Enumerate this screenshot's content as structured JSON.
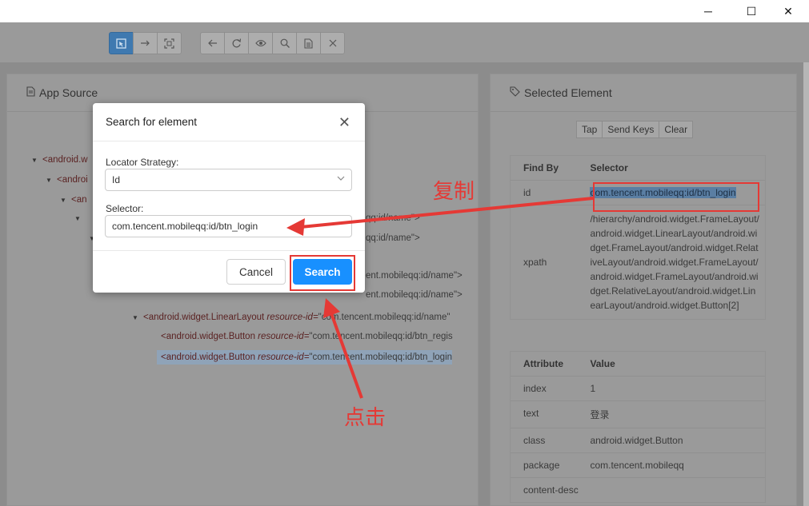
{
  "window": {
    "controls": [
      "─",
      "☐",
      "✕"
    ]
  },
  "toolbar": {
    "group1": [
      "select-element-icon",
      "swipe-icon",
      "tap-coordinates-icon"
    ],
    "group2": [
      "back-icon",
      "refresh-icon",
      "eye-icon",
      "search-icon",
      "copy-xml-icon",
      "quit-icon"
    ]
  },
  "app_source": {
    "title": "App Source",
    "tree": [
      {
        "text": "<android.w",
        "depth": 0,
        "caret": true
      },
      {
        "text": "<androi",
        "depth": 1,
        "caret": true
      },
      {
        "text": "<an",
        "depth": 2,
        "caret": true
      },
      {
        "tail": "qq:id/name\">",
        "depth": 3,
        "caret": true
      },
      {
        "tail": "qq:id/name\">",
        "depth": 4,
        "caret": true
      },
      {
        "tail": "ent.mobileqq:id/name\">",
        "depth": 5,
        "caret": false
      },
      {
        "tail": "ent.mobileqq:id/name\">",
        "depth": 5,
        "caret": false
      }
    ],
    "linear_layout": {
      "tag": "<android.widget.LinearLayout",
      "attr": "resource-id=",
      "value": "\"com.tencent.mobileqq:id/name\""
    },
    "button_register": {
      "tag": "<android.widget.Button",
      "attr": "resource-id=",
      "value": "\"com.tencent.mobileqq:id/btn_regis"
    },
    "button_login": {
      "tag": "<android.widget.Button",
      "attr": "resource-id=",
      "value": "\"com.tencent.mobileqq:id/btn_login"
    }
  },
  "selected_element": {
    "title": "Selected Element",
    "actions": [
      "Tap",
      "Send Keys",
      "Clear"
    ],
    "find_by_header": {
      "col1": "Find By",
      "col2": "Selector"
    },
    "find_by": [
      {
        "key": "id",
        "value": "com.tencent.mobileqq:id/btn_login"
      },
      {
        "key": "xpath",
        "value": "/hierarchy/android.widget.FrameLayout/android.widget.LinearLayout/android.widget.FrameLayout/android.widget.RelativeLayout/android.widget.FrameLayout/android.widget.FrameLayout/android.widget.RelativeLayout/android.widget.LinearLayout/android.widget.Button[2]"
      }
    ],
    "attr_header": {
      "col1": "Attribute",
      "col2": "Value"
    },
    "attributes": [
      {
        "key": "index",
        "value": "1"
      },
      {
        "key": "text",
        "value": "登录"
      },
      {
        "key": "class",
        "value": "android.widget.Button"
      },
      {
        "key": "package",
        "value": "com.tencent.mobileqq"
      },
      {
        "key": "content-desc",
        "value": ""
      }
    ]
  },
  "modal": {
    "title": "Search for element",
    "locator_label": "Locator Strategy:",
    "locator_value": "Id",
    "selector_label": "Selector:",
    "selector_value": "com.tencent.mobileqq:id/btn_login",
    "cancel": "Cancel",
    "search": "Search"
  },
  "annotations": {
    "copy": "复制",
    "click": "点击",
    "color": "#e53935"
  }
}
